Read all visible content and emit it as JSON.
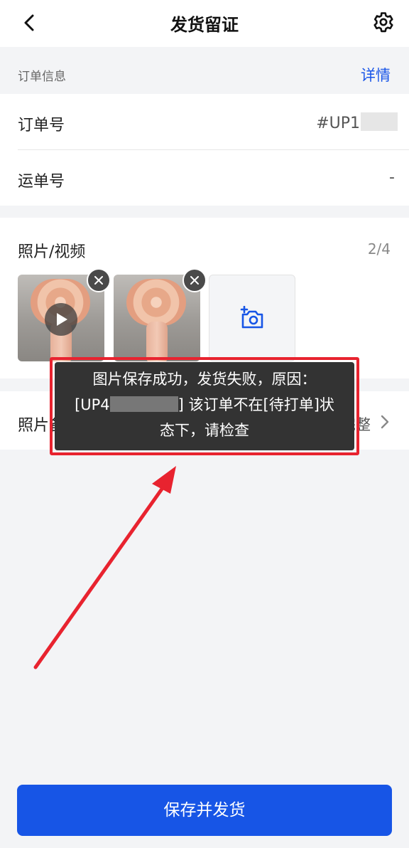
{
  "header": {
    "title": "发货留证"
  },
  "order_section": {
    "label": "订单信息",
    "detail_link": "详情",
    "rows": [
      {
        "key": "订单号",
        "value": "#UP1"
      },
      {
        "key": "运单号",
        "value": "-"
      }
    ]
  },
  "media": {
    "title": "照片/视频",
    "count": "2/4"
  },
  "note": {
    "key": "照片备注",
    "value": "货物完整"
  },
  "toast": {
    "line1": "图片保存成功，发货失败，原因：",
    "line2_prefix": "[UP4",
    "line2_suffix": "] 该订单不在[待打单]状",
    "line3": "态下，请检查",
    "border_color": "#e8232f"
  },
  "footer": {
    "submit_label": "保存并发货"
  },
  "colors": {
    "accent": "#1755e6",
    "link": "#1a56e8",
    "annotation_red": "#e8232f"
  }
}
